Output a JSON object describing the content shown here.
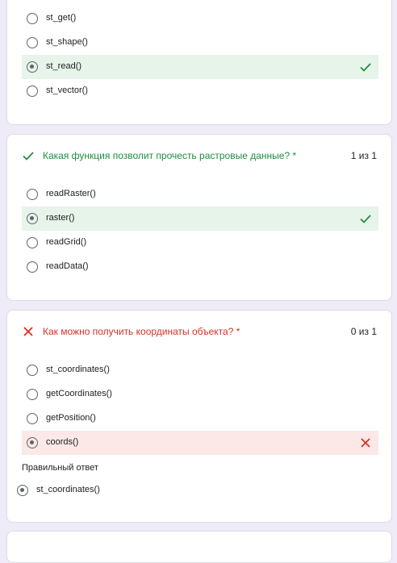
{
  "questions": [
    {
      "title": "",
      "score": "",
      "options": [
        {
          "label": "st_get()"
        },
        {
          "label": "st_shape()"
        },
        {
          "label": "st_read()"
        },
        {
          "label": "st_vector()"
        }
      ]
    },
    {
      "title": "Какая функция позволит прочесть растровые данные? *",
      "score": "1 из 1",
      "options": [
        {
          "label": "readRaster()"
        },
        {
          "label": "raster()"
        },
        {
          "label": "readGrid()"
        },
        {
          "label": "readData()"
        }
      ]
    },
    {
      "title": "Как можно получить координаты объекта? *",
      "score": "0 из 1",
      "options": [
        {
          "label": "st_coordinates()"
        },
        {
          "label": "getCoordinates()"
        },
        {
          "label": "getPosition()"
        },
        {
          "label": "coords()"
        }
      ],
      "correct_answer_caption": "Правильный ответ",
      "correct_answer": "st_coordinates()"
    }
  ],
  "colors": {
    "correct_text": "#1e8e3e",
    "correct_bg": "#e6f4ea",
    "wrong_text": "#d93025",
    "wrong_bg": "#fce8e6",
    "page_bg": "#f0ebf8"
  }
}
